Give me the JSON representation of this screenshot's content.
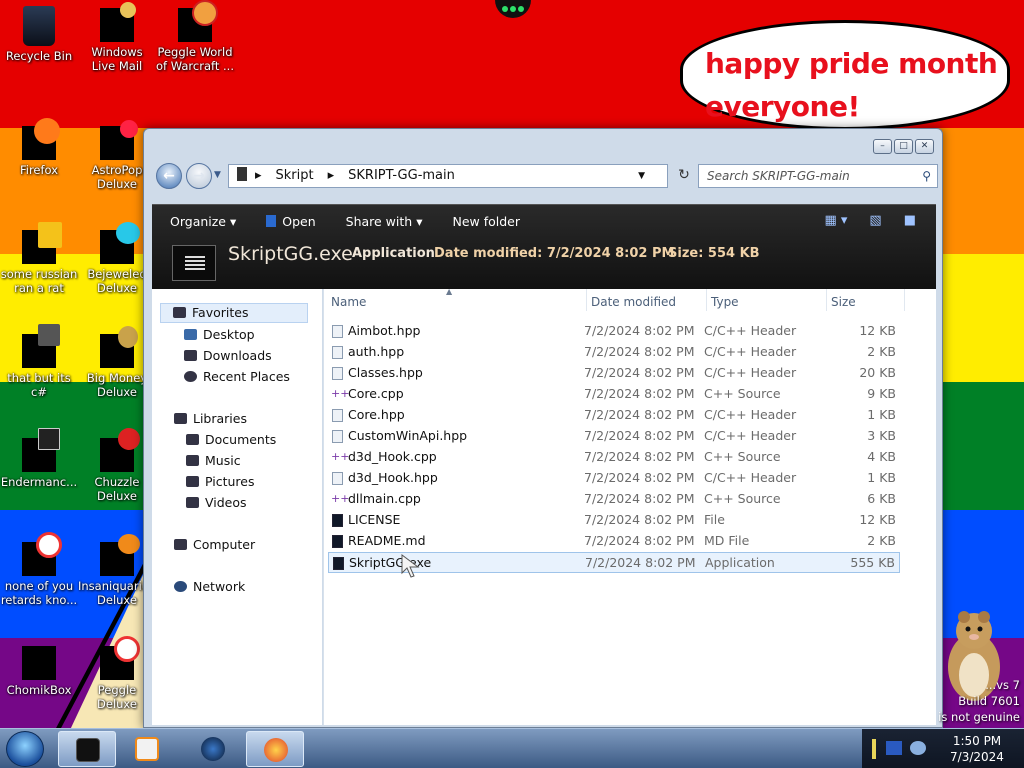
{
  "speech_bubble": {
    "line1": "happy pride month",
    "line2": "everyone!"
  },
  "desktop_icons": [
    {
      "label": "Recycle Bin"
    },
    {
      "label": "Windows Live Mail"
    },
    {
      "label": "Peggle World of Warcraft ..."
    },
    {
      "label": "Firefox"
    },
    {
      "label": "AstroPop Deluxe"
    },
    {
      "label": "some russian ran a rat"
    },
    {
      "label": "Bejeweled Deluxe"
    },
    {
      "label": "that but its c#"
    },
    {
      "label": "Big Money Deluxe"
    },
    {
      "label": "Endermanc..."
    },
    {
      "label": "Chuzzle Deluxe"
    },
    {
      "label": "none of you retards kno..."
    },
    {
      "label": "Insaniquarium Deluxe"
    },
    {
      "label": "ChomikBox"
    },
    {
      "label": "Peggle Deluxe"
    }
  ],
  "explorer": {
    "breadcrumb": [
      "Skript",
      "SKRIPT-GG-main"
    ],
    "search_placeholder": "Search SKRIPT-GG-main",
    "toolbar": {
      "organize": "Organize",
      "open": "Open",
      "share_with": "Share with",
      "new_folder": "New folder"
    },
    "details": {
      "file_name": "SkriptGG.exe",
      "file_type": "Application",
      "date_modified": "Date modified: 7/2/2024 8:02 PM",
      "size": "Size: 554 KB"
    },
    "nav": {
      "favorites": "Favorites",
      "desktop": "Desktop",
      "downloads": "Downloads",
      "recent": "Recent Places",
      "libraries": "Libraries",
      "documents": "Documents",
      "music": "Music",
      "pictures": "Pictures",
      "videos": "Videos",
      "computer": "Computer",
      "network": "Network"
    },
    "columns": {
      "name": "Name",
      "date": "Date modified",
      "type": "Type",
      "size": "Size"
    },
    "files": [
      {
        "name": "Aimbot.hpp",
        "date": "7/2/2024 8:02 PM",
        "type": "C/C++ Header",
        "size": "12 KB",
        "icon": "header-file-icon"
      },
      {
        "name": "auth.hpp",
        "date": "7/2/2024 8:02 PM",
        "type": "C/C++ Header",
        "size": "2 KB",
        "icon": "header-file-icon"
      },
      {
        "name": "Classes.hpp",
        "date": "7/2/2024 8:02 PM",
        "type": "C/C++ Header",
        "size": "20 KB",
        "icon": "header-file-icon"
      },
      {
        "name": "Core.cpp",
        "date": "7/2/2024 8:02 PM",
        "type": "C++ Source",
        "size": "9 KB",
        "icon": "source-file-icon"
      },
      {
        "name": "Core.hpp",
        "date": "7/2/2024 8:02 PM",
        "type": "C/C++ Header",
        "size": "1 KB",
        "icon": "header-file-icon"
      },
      {
        "name": "CustomWinApi.hpp",
        "date": "7/2/2024 8:02 PM",
        "type": "C/C++ Header",
        "size": "3 KB",
        "icon": "header-file-icon"
      },
      {
        "name": "d3d_Hook.cpp",
        "date": "7/2/2024 8:02 PM",
        "type": "C++ Source",
        "size": "4 KB",
        "icon": "source-file-icon"
      },
      {
        "name": "d3d_Hook.hpp",
        "date": "7/2/2024 8:02 PM",
        "type": "C/C++ Header",
        "size": "1 KB",
        "icon": "header-file-icon"
      },
      {
        "name": "dllmain.cpp",
        "date": "7/2/2024 8:02 PM",
        "type": "C++ Source",
        "size": "6 KB",
        "icon": "source-file-icon"
      },
      {
        "name": "LICENSE",
        "date": "7/2/2024 8:02 PM",
        "type": "File",
        "size": "12 KB",
        "icon": "generic-file-icon"
      },
      {
        "name": "README.md",
        "date": "7/2/2024 8:02 PM",
        "type": "MD File",
        "size": "2 KB",
        "icon": "generic-file-icon"
      },
      {
        "name": "SkriptGG.exe",
        "date": "7/2/2024 8:02 PM",
        "type": "Application",
        "size": "555 KB",
        "icon": "application-icon"
      }
    ]
  },
  "taskbar": {
    "time": "1:50 PM",
    "date": "7/3/2024"
  },
  "watermark": {
    "line1": "...vs 7",
    "line2": "Build 7601",
    "line3": "is not genuine"
  }
}
